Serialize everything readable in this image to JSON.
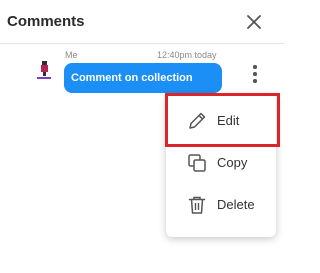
{
  "header": {
    "title": "Comments"
  },
  "comment": {
    "sender": "Me",
    "time": "12:40pm today",
    "text": "Comment on collection"
  },
  "menu": {
    "items": [
      {
        "label": "Edit",
        "icon": "pencil-icon"
      },
      {
        "label": "Copy",
        "icon": "copy-icon"
      },
      {
        "label": "Delete",
        "icon": "trash-icon"
      }
    ]
  },
  "colors": {
    "bubble": "#1b8ff5",
    "highlight": "#d9262a"
  }
}
